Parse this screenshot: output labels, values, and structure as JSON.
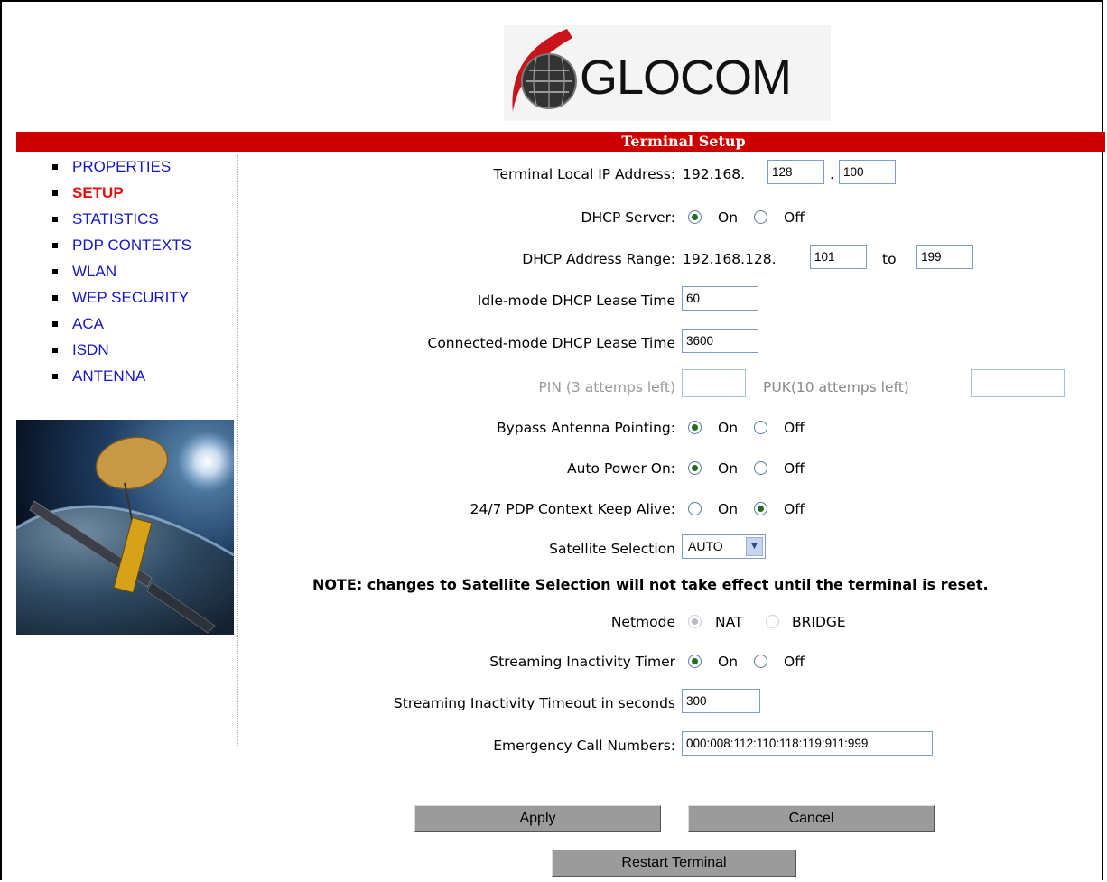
{
  "logo": {
    "text": "GLOCOM"
  },
  "banner": {
    "title": "Terminal Setup"
  },
  "nav": {
    "items": [
      {
        "label": "PROPERTIES"
      },
      {
        "label": "SETUP"
      },
      {
        "label": "STATISTICS"
      },
      {
        "label": "PDP CONTEXTS"
      },
      {
        "label": "WLAN"
      },
      {
        "label": "WEP SECURITY"
      },
      {
        "label": "ACA"
      },
      {
        "label": "ISDN"
      },
      {
        "label": "ANTENNA"
      }
    ],
    "active": "SETUP"
  },
  "form": {
    "ip": {
      "label": "Terminal Local IP Address:",
      "prefix": "192.168.",
      "octet3": "128",
      "sep": ".",
      "octet4": "100"
    },
    "dhcp_server": {
      "label": "DHCP Server:",
      "on": "On",
      "off": "Off",
      "selected": "On"
    },
    "dhcp_range": {
      "label": "DHCP Address Range:",
      "prefix": "192.168.128.",
      "start": "101",
      "to": "to",
      "end": "199"
    },
    "idle_lease": {
      "label": "Idle-mode DHCP Lease Time",
      "value": "60"
    },
    "connected_lease": {
      "label": "Connected-mode DHCP Lease Time",
      "value": "3600"
    },
    "pin": {
      "label": "PIN (3 attemps left)",
      "value": ""
    },
    "puk": {
      "label": "PUK(10 attemps left)",
      "value": ""
    },
    "bypass": {
      "label": "Bypass Antenna Pointing:",
      "on": "On",
      "off": "Off",
      "selected": "On"
    },
    "auto_power": {
      "label": "Auto Power On:",
      "on": "On",
      "off": "Off",
      "selected": "On"
    },
    "keep_alive": {
      "label": "24/7 PDP Context Keep Alive:",
      "on": "On",
      "off": "Off",
      "selected": "Off"
    },
    "satellite": {
      "label": "Satellite Selection",
      "value": "AUTO"
    },
    "note": "NOTE: changes to Satellite Selection will not take effect until the terminal is reset.",
    "netmode": {
      "label": "Netmode",
      "nat": "NAT",
      "bridge": "BRIDGE",
      "selected": "NAT"
    },
    "streaming_timer": {
      "label": "Streaming Inactivity Timer",
      "on": "On",
      "off": "Off",
      "selected": "On"
    },
    "streaming_timeout": {
      "label": "Streaming Inactivity Timeout in seconds",
      "value": "300"
    },
    "emergency": {
      "label": "Emergency Call Numbers:",
      "value": "000:008:112:110:118:119:911:999"
    }
  },
  "buttons": {
    "apply": "Apply",
    "cancel": "Cancel",
    "restart": "Restart Terminal"
  },
  "colors": {
    "banner": "#cc0000",
    "nav_link": "#1515c8",
    "nav_active": "#e31010"
  }
}
